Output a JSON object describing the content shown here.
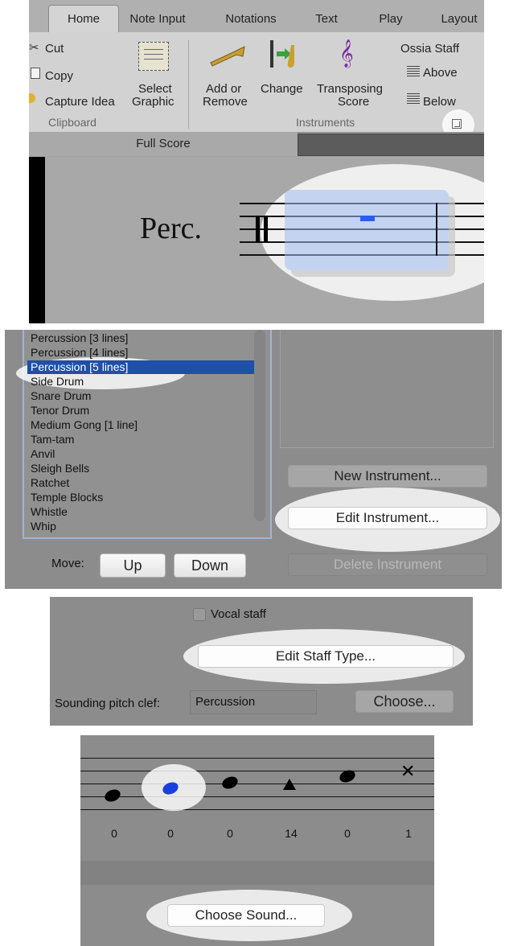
{
  "ribbon": {
    "tabs": [
      "Home",
      "Note Input",
      "Notations",
      "Text",
      "Play",
      "Layout"
    ],
    "clipboard": {
      "cut": "Cut",
      "copy": "Copy",
      "capture_idea": "Capture Idea",
      "select_graphic_line1": "Select",
      "select_graphic_line2": "Graphic",
      "group_label": "Clipboard"
    },
    "instruments": {
      "add_remove_line1": "Add or",
      "add_remove_line2": "Remove",
      "change": "Change",
      "transposing_line1": "Transposing",
      "transposing_line2": "Score",
      "ossia_staff": "Ossia Staff",
      "above": "Above",
      "below": "Below",
      "group_label": "Instruments"
    },
    "score_tab": "Full Score"
  },
  "score": {
    "instrument_label": "Perc."
  },
  "instrument_list": {
    "items": [
      "Percussion [3 lines]",
      "Percussion [4 lines]",
      "Percussion [5 lines]",
      "Side Drum",
      "Snare Drum",
      "Tenor Drum",
      "Medium Gong [1 line]",
      "Tam-tam",
      "Anvil",
      "Sleigh Bells",
      "Ratchet",
      "Temple Blocks",
      "Whistle",
      "Whip"
    ],
    "selected_index": 2,
    "move_label": "Move:",
    "up": "Up",
    "down": "Down",
    "new_instrument": "New Instrument...",
    "edit_instrument": "Edit Instrument...",
    "delete_instrument": "Delete Instrument"
  },
  "staff_dialog": {
    "vocal_staff": "Vocal staff",
    "edit_staff_type": "Edit Staff Type...",
    "sounding_pitch_clef_label": "Sounding pitch clef:",
    "sounding_pitch_clef_value": "Percussion",
    "choose": "Choose..."
  },
  "sound_editor": {
    "note_values": [
      "0",
      "0",
      "0",
      "14",
      "0",
      "1"
    ],
    "choose_sound": "Choose Sound..."
  },
  "colors": {
    "selection_blue": "#1f4fa8",
    "note_blue": "#1a3fe0",
    "dialog_gray": "#8a8a8a"
  }
}
